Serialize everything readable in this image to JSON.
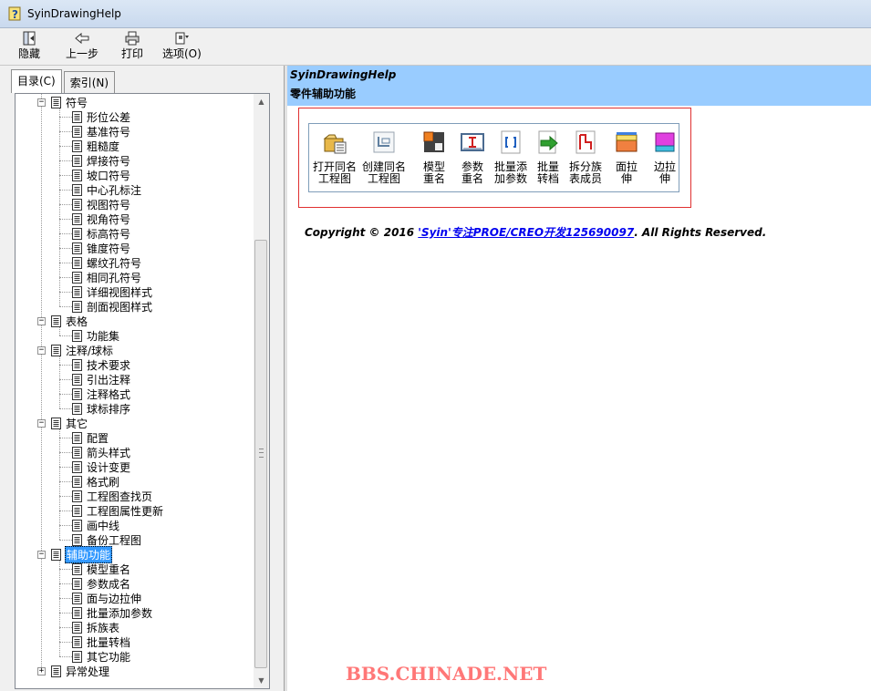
{
  "window": {
    "title": "SyinDrawingHelp"
  },
  "toolbar": {
    "hide": "隐藏",
    "back": "上一步",
    "print": "打印",
    "options": "选项(O)"
  },
  "tabs": {
    "contents": "目录(C)",
    "index": "索引(N)"
  },
  "tree": [
    {
      "label": "符号",
      "level": 0,
      "expander": "minus"
    },
    {
      "label": "形位公差",
      "level": 1
    },
    {
      "label": "基准符号",
      "level": 1
    },
    {
      "label": "粗糙度",
      "level": 1
    },
    {
      "label": "焊接符号",
      "level": 1
    },
    {
      "label": "坡口符号",
      "level": 1
    },
    {
      "label": "中心孔标注",
      "level": 1
    },
    {
      "label": "视图符号",
      "level": 1
    },
    {
      "label": "视角符号",
      "level": 1
    },
    {
      "label": "标高符号",
      "level": 1
    },
    {
      "label": "锥度符号",
      "level": 1
    },
    {
      "label": "螺纹孔符号",
      "level": 1
    },
    {
      "label": "相同孔符号",
      "level": 1
    },
    {
      "label": "详细视图样式",
      "level": 1
    },
    {
      "label": "剖面视图样式",
      "level": 1
    },
    {
      "label": "表格",
      "level": 0,
      "expander": "minus"
    },
    {
      "label": "功能集",
      "level": 1
    },
    {
      "label": "注释/球标",
      "level": 0,
      "expander": "minus"
    },
    {
      "label": "技术要求",
      "level": 1
    },
    {
      "label": "引出注释",
      "level": 1
    },
    {
      "label": "注释格式",
      "level": 1
    },
    {
      "label": "球标排序",
      "level": 1
    },
    {
      "label": "其它",
      "level": 0,
      "expander": "minus"
    },
    {
      "label": "配置",
      "level": 1
    },
    {
      "label": "箭头样式",
      "level": 1
    },
    {
      "label": "设计变更",
      "level": 1
    },
    {
      "label": "格式刷",
      "level": 1
    },
    {
      "label": "工程图查找页",
      "level": 1
    },
    {
      "label": "工程图属性更新",
      "level": 1
    },
    {
      "label": "画中线",
      "level": 1
    },
    {
      "label": "备份工程图",
      "level": 1
    },
    {
      "label": "辅助功能",
      "level": 0,
      "expander": "minus",
      "selected": true
    },
    {
      "label": "模型重名",
      "level": 1
    },
    {
      "label": "参数成名",
      "level": 1
    },
    {
      "label": "面与边拉伸",
      "level": 1
    },
    {
      "label": "批量添加参数",
      "level": 1
    },
    {
      "label": "拆族表",
      "level": 1
    },
    {
      "label": "批量转档",
      "level": 1
    },
    {
      "label": "其它功能",
      "level": 1
    },
    {
      "label": "异常处理",
      "level": 0,
      "expander": "plus"
    }
  ],
  "content": {
    "app_name": "SyinDrawingHelp",
    "section_title": "零件辅助功能",
    "ribbon": [
      {
        "label": "打开同名\n工程图",
        "icon": "open-folder-icon"
      },
      {
        "label": "创建同名\n工程图",
        "icon": "drawing-sheet-icon"
      },
      {
        "label": "模型\n重名",
        "icon": "save-rename-icon"
      },
      {
        "label": "参数\n重名",
        "icon": "parameter-icon"
      },
      {
        "label": "批量添\n加参数",
        "icon": "bracket-doc-icon"
      },
      {
        "label": "批量\n转档",
        "icon": "convert-arrow-icon"
      },
      {
        "label": "拆分族\n表成员",
        "icon": "split-family-icon"
      },
      {
        "label": "面拉\n伸",
        "icon": "surface-extrude-icon"
      },
      {
        "label": "边拉\n伸",
        "icon": "edge-extrude-icon"
      }
    ],
    "copyright_pre": "Copyright © 2016 ",
    "copyright_link": "'Syin'专注PROE/CREO开发125690097",
    "copyright_post": ". All Rights Reserved."
  },
  "watermark": "BBS.CHINADE.NET",
  "colors": {
    "header_band": "#99ccff",
    "selection": "#3399ff",
    "watermark": "#ff7777",
    "red_frame": "#e03030"
  }
}
